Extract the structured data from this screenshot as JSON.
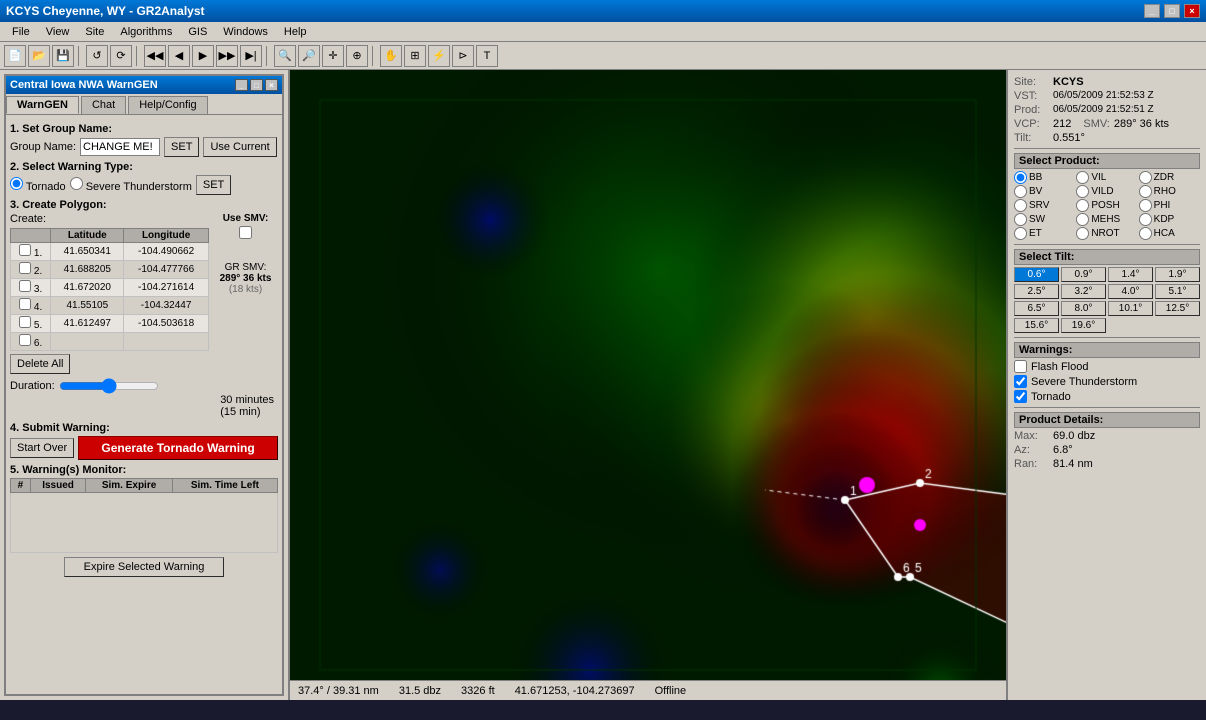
{
  "titlebar": {
    "title": "KCYS Cheyenne, WY - GR2Analyst",
    "controls": [
      "_",
      "□",
      "×"
    ]
  },
  "menubar": {
    "items": [
      "File",
      "View",
      "Site",
      "Algorithms",
      "GIS",
      "Windows",
      "Help"
    ]
  },
  "warngem_window": {
    "title": "Central Iowa NWA WarnGEN",
    "tabs": [
      "WarnGEN",
      "Chat",
      "Help/Config"
    ]
  },
  "warngen": {
    "section1": "1. Set Group Name:",
    "group_label": "Group Name:",
    "group_value": "CHANGE ME!",
    "set_btn": "SET",
    "use_current_btn": "Use Current",
    "section2": "2. Select Warning Type:",
    "tornado_radio": "Tornado",
    "severe_radio": "Severe Thunderstorm",
    "set2_btn": "SET",
    "section3": "3. Create Polygon:",
    "create_label": "Create:",
    "lat_header": "Latitude",
    "lon_header": "Longitude",
    "use_smv_header": "Use SMV:",
    "rows": [
      {
        "num": "1.",
        "lat": "41.650341",
        "lon": "-104.490662"
      },
      {
        "num": "2.",
        "lat": "41.688205",
        "lon": "-104.477766"
      },
      {
        "num": "3.",
        "lat": "41.672020",
        "lon": "-104.271614"
      },
      {
        "num": "4.",
        "lat": "41.55105",
        "lon": "-104.32447"
      },
      {
        "num": "5.",
        "lat": "41.612497",
        "lon": "-104.503618"
      },
      {
        "num": "6.",
        "lat": "",
        "lon": ""
      }
    ],
    "delete_all_btn": "Delete All",
    "gr_smv_label": "GR SMV:",
    "gr_smv_value": "289° 36 kts",
    "gr_smv_note": "(18 kts)",
    "duration_label": "Duration:",
    "duration_value": "30 minutes",
    "duration_sub": "(15 min)",
    "section4": "4. Submit Warning:",
    "start_over_btn": "Start Over",
    "generate_btn": "Generate Tornado Warning",
    "section5": "5. Warning(s) Monitor:",
    "monitor_headers": [
      "#",
      "Issued",
      "Sim. Expire",
      "Sim. Time Left"
    ],
    "expire_btn": "Expire Selected Warning"
  },
  "right_panel": {
    "site_label": "Site:",
    "site_value": "KCYS",
    "vst_label": "VST:",
    "vst_value": "06/05/2009 21:52:53 Z",
    "prod_label": "Prod:",
    "prod_value": "06/05/2009 21:52:51 Z",
    "vcp_label": "VCP:",
    "vcp_value": "212",
    "smv_label": "SMV:",
    "smv_value": "289° 36 kts",
    "tilt_label": "Tilt:",
    "tilt_value": "0.551°",
    "select_product": "Select Product:",
    "products": [
      {
        "id": "BB",
        "selected": true
      },
      {
        "id": "VIL",
        "selected": false
      },
      {
        "id": "ZDR",
        "selected": false
      },
      {
        "id": "BV",
        "selected": false
      },
      {
        "id": "VILD",
        "selected": false
      },
      {
        "id": "RHO",
        "selected": false
      },
      {
        "id": "SRV",
        "selected": false
      },
      {
        "id": "POSH",
        "selected": false
      },
      {
        "id": "PHI",
        "selected": false
      },
      {
        "id": "SW",
        "selected": false
      },
      {
        "id": "MEHS",
        "selected": false
      },
      {
        "id": "KDP",
        "selected": false
      },
      {
        "id": "ET",
        "selected": false
      },
      {
        "id": "NROT",
        "selected": false
      },
      {
        "id": "HCA",
        "selected": false
      }
    ],
    "select_tilt": "Select Tilt:",
    "tilts": [
      "0.6°",
      "0.9°",
      "1.4°",
      "1.9°",
      "2.5°",
      "3.2°",
      "4.0°",
      "5.1°",
      "6.5°",
      "8.0°",
      "10.1°",
      "12.5°",
      "15.6°",
      "19.6°"
    ],
    "active_tilt": "0.6°",
    "warnings_label": "Warnings:",
    "warnings": [
      {
        "label": "Flash Flood",
        "checked": false
      },
      {
        "label": "Severe Thunderstorm",
        "checked": true
      },
      {
        "label": "Tornado",
        "checked": true
      }
    ],
    "product_details": "Product Details:",
    "max_label": "Max:",
    "max_value": "69.0 dbz",
    "az_label": "Az:",
    "az_value": "6.8°",
    "ran_label": "Ran:",
    "ran_value": "81.4 nm"
  },
  "statusbar": {
    "coord1": "37.4° / 39.31 nm",
    "dbz": "31.5 dbz",
    "altitude": "3326 ft",
    "latlon": "41.671253, -104.273697",
    "mode": "Offline"
  }
}
